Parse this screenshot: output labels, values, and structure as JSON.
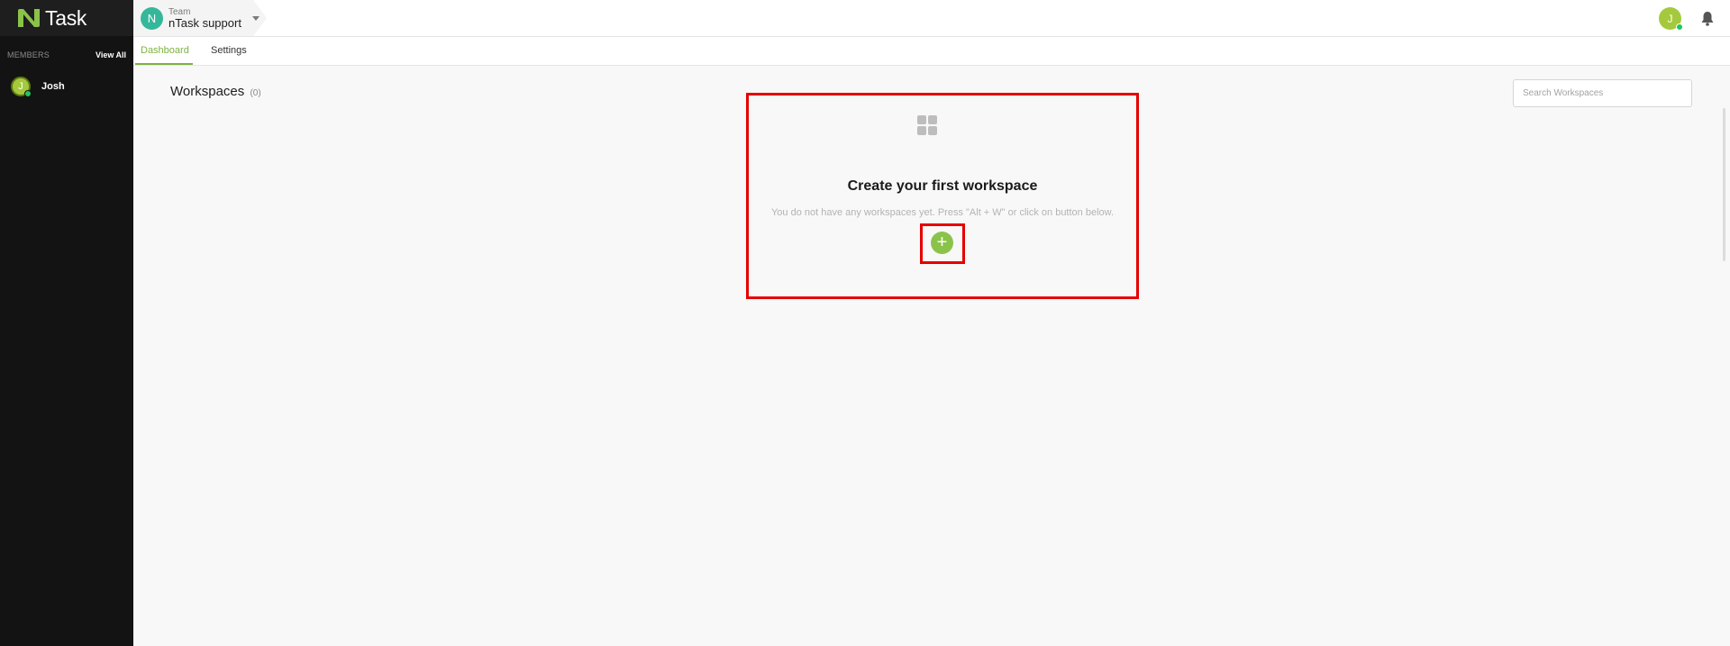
{
  "app": {
    "logo_text": "Task"
  },
  "sidebar": {
    "members_label": "MEMBERS",
    "view_all_label": "View All",
    "members": [
      {
        "initial": "J",
        "name": "Josh",
        "status": "online"
      }
    ]
  },
  "header": {
    "team_initial": "N",
    "team_kicker": "Team",
    "team_name": "nTask support",
    "user_initial": "J"
  },
  "tabs": [
    {
      "label": "Dashboard",
      "active": true
    },
    {
      "label": "Settings",
      "active": false
    }
  ],
  "workspaces": {
    "title": "Workspaces",
    "count": "(0)",
    "search_placeholder": "Search Workspaces",
    "empty_title": "Create your first workspace",
    "empty_description": "You do not have any workspaces yet. Press \"Alt + W\" or click on button below.",
    "add_glyph": "+"
  },
  "colors": {
    "accent": "#7cb342",
    "sidebar_bg": "#131313",
    "highlight": "#e60000",
    "team_avatar": "#35b79a"
  },
  "icons": [
    "ntask-logo-icon",
    "chevron-down-icon",
    "bell-icon",
    "grid-icon",
    "plus-icon"
  ]
}
